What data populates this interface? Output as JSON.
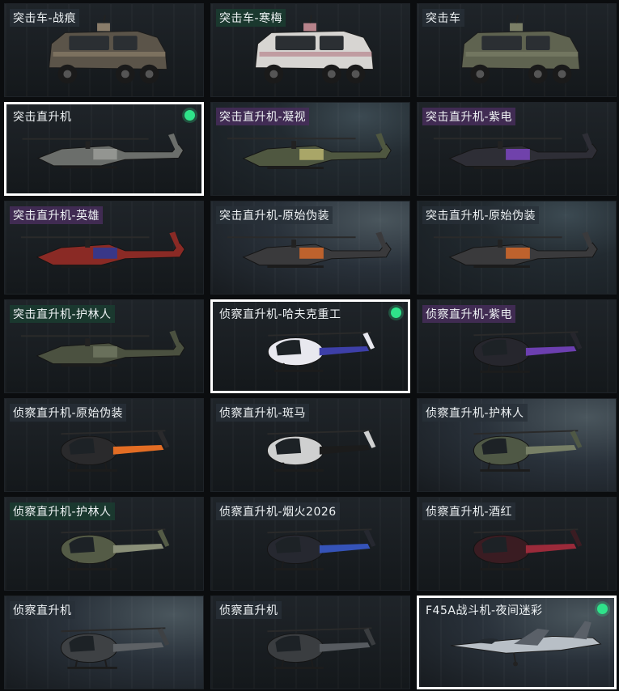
{
  "items": [
    {
      "label": "突击车-战痕",
      "kind": "truck",
      "body": "#5b5449",
      "accent": "#8a7d6a",
      "tag": "grey",
      "bg": "dark"
    },
    {
      "label": "突击车-寒梅",
      "kind": "truck",
      "body": "#d7d5d2",
      "accent": "#b7838b",
      "tag": "green",
      "bg": "dark"
    },
    {
      "label": "突击车",
      "kind": "truck",
      "body": "#5f6350",
      "accent": "#7b7f66",
      "tag": "grey",
      "bg": "dark"
    },
    {
      "label": "突击直升机",
      "kind": "attack",
      "body": "#6b6e6b",
      "accent": "#9a9c98",
      "tag": "grey",
      "bg": "dark",
      "selected": true,
      "equipped": true
    },
    {
      "label": "突击直升机-凝视",
      "kind": "attack",
      "body": "#4f5740",
      "accent": "#b9b470",
      "tag": "purple",
      "bg": "teal"
    },
    {
      "label": "突击直升机-紫电",
      "kind": "attack",
      "body": "#2e2e36",
      "accent": "#7b45c0",
      "tag": "purple",
      "bg": "dark"
    },
    {
      "label": "突击直升机-英雄",
      "kind": "attack",
      "body": "#8a2a25",
      "accent": "#2a3a9a",
      "tag": "purple",
      "bg": "dark"
    },
    {
      "label": "突击直升机-原始伪装",
      "kind": "attack",
      "body": "#3a3a3c",
      "accent": "#d66a2a",
      "tag": "grey",
      "bg": "slate"
    },
    {
      "label": "突击直升机-原始伪装",
      "kind": "attack",
      "body": "#3a3a3c",
      "accent": "#d66a2a",
      "tag": "grey",
      "bg": "teal"
    },
    {
      "label": "突击直升机-护林人",
      "kind": "attack",
      "body": "#4b5140",
      "accent": "#6e7560",
      "tag": "green",
      "bg": "dark"
    },
    {
      "label": "侦察直升机-哈夫克重工",
      "kind": "scout",
      "body": "#e8e8ef",
      "accent": "#3d3fa8",
      "tag": "grey",
      "bg": "dark",
      "selected": true,
      "equipped": true
    },
    {
      "label": "侦察直升机-紫电",
      "kind": "scout",
      "body": "#26262d",
      "accent": "#6c3fb0",
      "tag": "purple",
      "bg": "dark"
    },
    {
      "label": "侦察直升机-原始伪装",
      "kind": "scout",
      "body": "#2a2a2c",
      "accent": "#e36d24",
      "tag": "grey",
      "bg": "dark"
    },
    {
      "label": "侦察直升机-斑马",
      "kind": "scout",
      "body": "#cfd0d0",
      "accent": "#1b1b1b",
      "tag": "grey",
      "bg": "dark"
    },
    {
      "label": "侦察直升机-护林人",
      "kind": "scout",
      "body": "#4f5845",
      "accent": "#777f66",
      "tag": "grey",
      "bg": "slate"
    },
    {
      "label": "侦察直升机-护林人",
      "kind": "scout",
      "body": "#545b46",
      "accent": "#8a8f78",
      "tag": "green",
      "bg": "dark"
    },
    {
      "label": "侦察直升机-烟火2026",
      "kind": "scout",
      "body": "#262830",
      "accent": "#3553b8",
      "tag": "grey",
      "bg": "dark"
    },
    {
      "label": "侦察直升机-酒红",
      "kind": "scout",
      "body": "#3a1c22",
      "accent": "#9b2a3a",
      "tag": "grey",
      "bg": "dark"
    },
    {
      "label": "侦察直升机",
      "kind": "scout",
      "body": "#3e4144",
      "accent": "#5d6165",
      "tag": "grey",
      "bg": "slate"
    },
    {
      "label": "侦察直升机",
      "kind": "scout",
      "body": "#3a3d40",
      "accent": "#575b60",
      "tag": "grey",
      "bg": "dark"
    },
    {
      "label": "F45A战斗机-夜间迷彩",
      "kind": "jet",
      "body": "#b8bfc6",
      "accent": "#5a6068",
      "tag": "grey",
      "bg": "slate",
      "selected": true,
      "equipped": true
    }
  ]
}
